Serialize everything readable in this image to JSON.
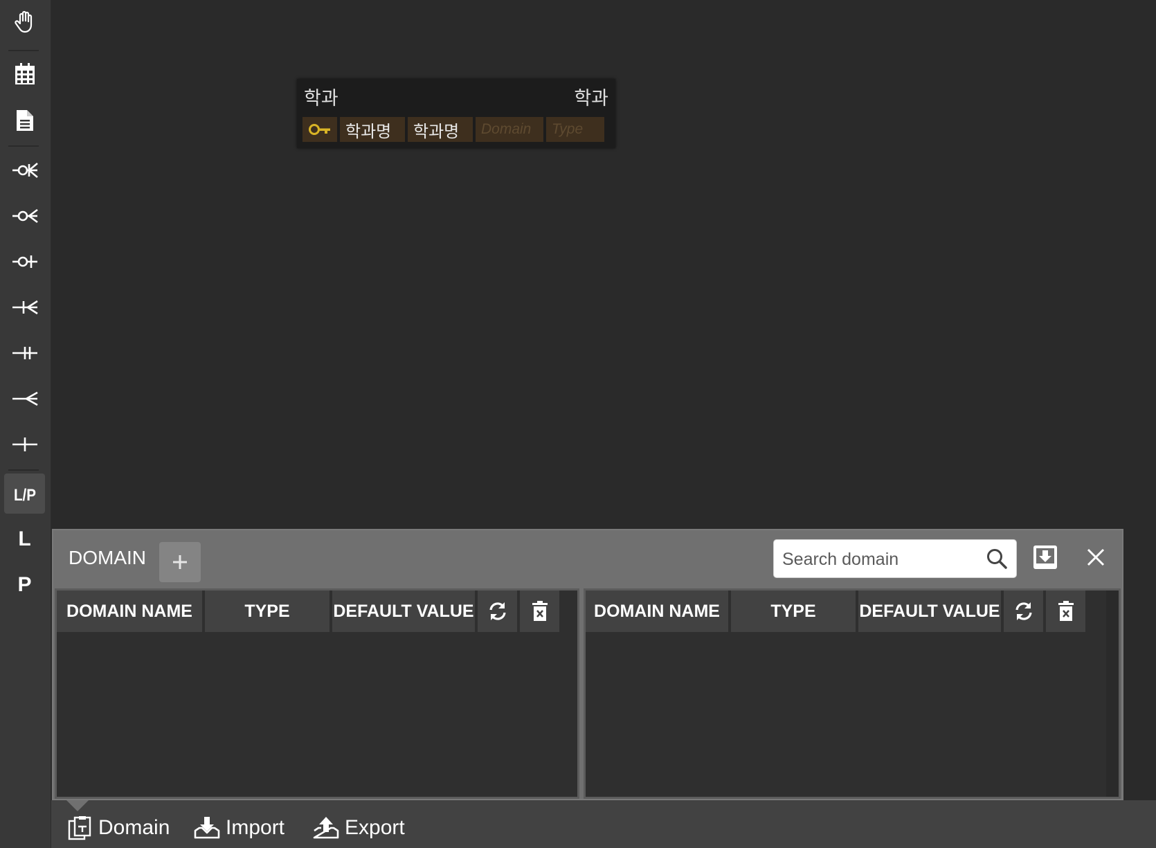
{
  "toolbar": {
    "items": [
      {
        "name": "hand-tool",
        "icon": "hand-icon"
      },
      {
        "name": "table-tool",
        "icon": "table-grid-icon"
      },
      {
        "name": "memo-tool",
        "icon": "document-icon"
      },
      {
        "name": "zero-one-n-tool",
        "icon": "relation-zero-one-n-icon"
      },
      {
        "name": "zero-n-tool",
        "icon": "relation-zero-n-icon"
      },
      {
        "name": "zero-one-tool",
        "icon": "relation-zero-one-icon"
      },
      {
        "name": "one-n-tool",
        "icon": "relation-one-n-icon"
      },
      {
        "name": "one-one-tool",
        "icon": "relation-one-one-icon"
      },
      {
        "name": "n-tool",
        "icon": "relation-n-icon"
      },
      {
        "name": "one-tool",
        "icon": "relation-one-icon"
      },
      {
        "name": "logical-physical-tool",
        "label": "L/P",
        "active": true
      },
      {
        "name": "logical-tool",
        "label": "L"
      },
      {
        "name": "physical-tool",
        "label": "P"
      }
    ]
  },
  "canvas": {
    "table": {
      "name": "학과",
      "comment": "학과",
      "columns": [
        {
          "icon": "primary-key-icon",
          "name": "학과명",
          "comment": "학과명",
          "domain": "Domain",
          "type": "Type"
        }
      ]
    }
  },
  "domain_panel": {
    "title": "DOMAIN",
    "search": {
      "placeholder": "Search domain",
      "value": ""
    },
    "left_grid": {
      "headers": [
        "DOMAIN NAME",
        "TYPE",
        "DEFAULT VALUE"
      ]
    },
    "right_grid": {
      "headers": [
        "DOMAIN NAME",
        "TYPE",
        "DEFAULT VALUE"
      ]
    }
  },
  "bottom_bar": {
    "items": [
      {
        "label": "Domain",
        "icon": "domain-icon"
      },
      {
        "label": "Import",
        "icon": "import-icon"
      },
      {
        "label": "Export",
        "icon": "export-icon"
      }
    ]
  },
  "colors": {
    "background": "#2a2a2a",
    "toolbar": "#383838",
    "panel": "#707070",
    "grid_body": "#2f2f2f",
    "grid_header": "#424242",
    "column_cell": "#3e2f1e",
    "primary_key": "#d9b426"
  }
}
